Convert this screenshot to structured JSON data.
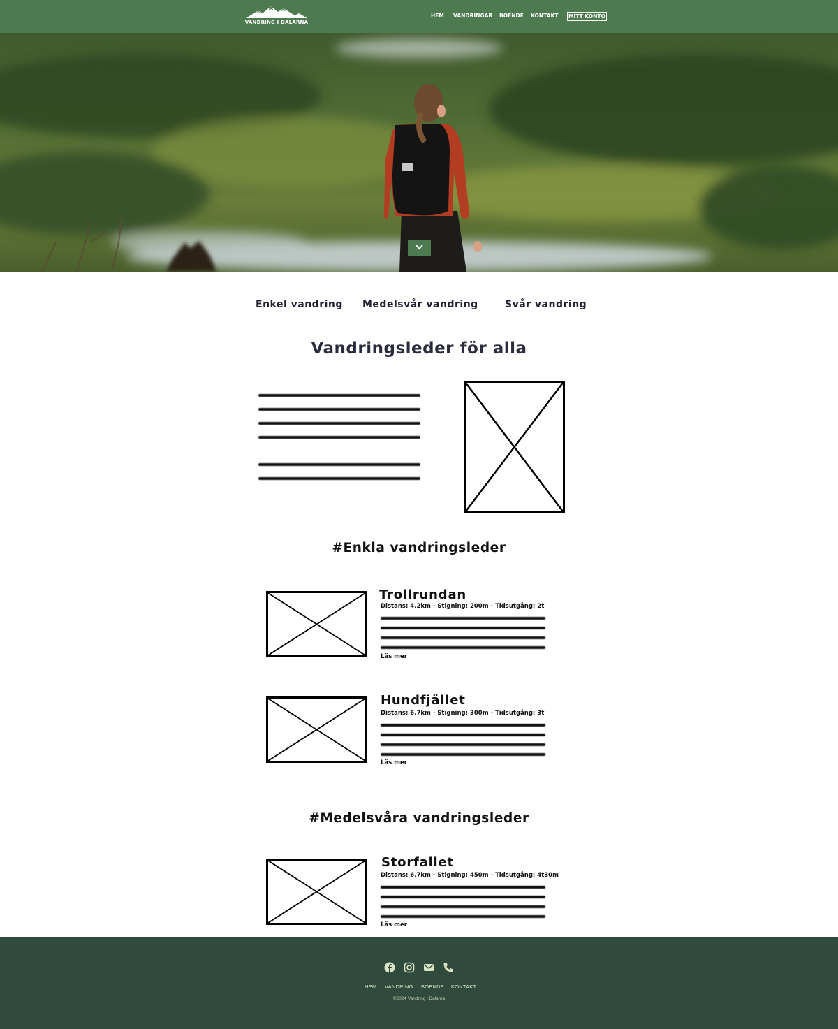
{
  "header": {
    "logo_text": "VANDRING I DALARNA",
    "nav": [
      {
        "label": "HEM"
      },
      {
        "label": "VANDRINGAR"
      },
      {
        "label": "BOENDE"
      },
      {
        "label": "KONTAKT"
      },
      {
        "label": "MITT KONTO"
      }
    ]
  },
  "hero": {
    "scroll_icon": "chevron-down-icon",
    "image_subject": "hiker-with-backpack-overlooking-forest-and-lake"
  },
  "levels": [
    {
      "label": "Enkel vandring"
    },
    {
      "label": "Medelsvår vandring"
    },
    {
      "label": "Svår vandring"
    }
  ],
  "intro": {
    "title": "Vandringsleder för alla"
  },
  "sections": {
    "easy": {
      "title": "#Enkla vandringsleder",
      "trails": [
        {
          "name": "Trollrundan",
          "meta": "Distans: 4.2km - Stigning: 200m - Tidsutgång: 2t",
          "link": "Läs mer"
        },
        {
          "name": "Hundfjället",
          "meta": "Distans: 6.7km - Stigning: 300m - Tidsutgång: 3t",
          "link": "Läs mer"
        }
      ]
    },
    "medium": {
      "title": "#Medelsvåra vandringsleder",
      "trails": [
        {
          "name": "Storfallet",
          "meta": "Distans: 6.7km - Stigning: 450m - Tidsutgång: 4t30m",
          "link": "Läs mer"
        }
      ]
    }
  },
  "footer": {
    "social_icons": [
      "facebook-icon",
      "instagram-icon",
      "envelope-icon",
      "phone-icon"
    ],
    "links": [
      {
        "label": "HEM"
      },
      {
        "label": "VANDRING"
      },
      {
        "label": "BOENDE"
      },
      {
        "label": "KONTAKT"
      }
    ],
    "copyright": "©2024 Vandring i Dalarna"
  },
  "colors": {
    "header_green": "#4d7a4e",
    "footer_green": "#304b3e",
    "footer_text": "#d9e4c6",
    "heading_dark": "#2a2c3d"
  }
}
